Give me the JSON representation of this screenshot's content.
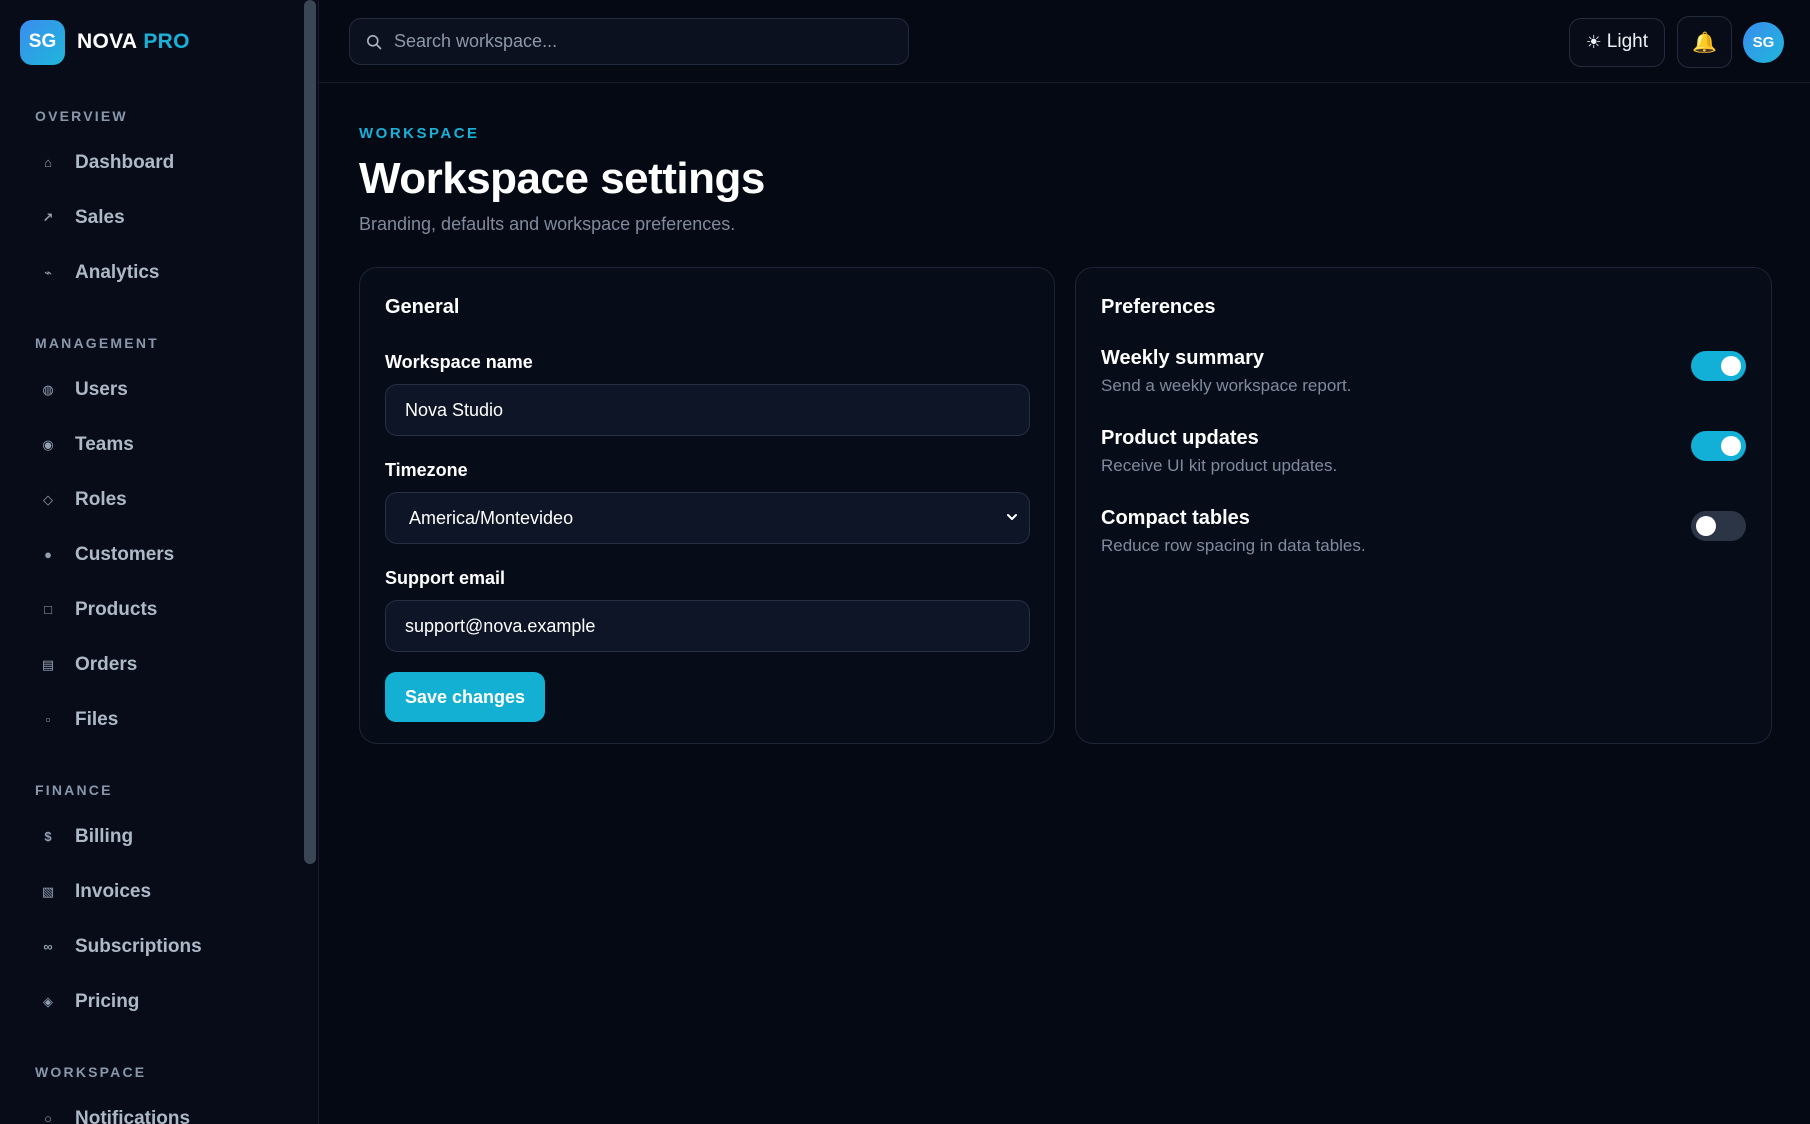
{
  "brand": {
    "logo": "SG",
    "name": "NOVA",
    "accent": "PRO"
  },
  "sidebar": {
    "sections": [
      {
        "title": "OVERVIEW",
        "items": [
          {
            "label": "Dashboard",
            "icon": "⌂"
          },
          {
            "label": "Sales",
            "icon": "↗"
          },
          {
            "label": "Analytics",
            "icon": "⌁"
          }
        ]
      },
      {
        "title": "MANAGEMENT",
        "items": [
          {
            "label": "Users",
            "icon": "◍"
          },
          {
            "label": "Teams",
            "icon": "◉"
          },
          {
            "label": "Roles",
            "icon": "◇"
          },
          {
            "label": "Customers",
            "icon": "●"
          },
          {
            "label": "Products",
            "icon": "□"
          },
          {
            "label": "Orders",
            "icon": "▤"
          },
          {
            "label": "Files",
            "icon": "▫"
          }
        ]
      },
      {
        "title": "FINANCE",
        "items": [
          {
            "label": "Billing",
            "icon": "$"
          },
          {
            "label": "Invoices",
            "icon": "▧"
          },
          {
            "label": "Subscriptions",
            "icon": "∞"
          },
          {
            "label": "Pricing",
            "icon": "◈"
          }
        ]
      },
      {
        "title": "WORKSPACE",
        "items": [
          {
            "label": "Notifications",
            "icon": "○"
          }
        ]
      }
    ]
  },
  "topbar": {
    "search_placeholder": "Search workspace...",
    "theme_label": "Light",
    "theme_icon": "☀",
    "bell_icon": "🔔",
    "avatar": "SG"
  },
  "page": {
    "eyebrow": "WORKSPACE",
    "title": "Workspace settings",
    "subtitle": "Branding, defaults and workspace preferences."
  },
  "general": {
    "title": "General",
    "workspace_name_label": "Workspace name",
    "workspace_name_value": "Nova Studio",
    "timezone_label": "Timezone",
    "timezone_value": "America/Montevideo",
    "support_email_label": "Support email",
    "support_email_value": "support@nova.example",
    "save_label": "Save changes"
  },
  "preferences": {
    "title": "Preferences",
    "items": [
      {
        "title": "Weekly summary",
        "description": "Send a weekly workspace report.",
        "enabled": true
      },
      {
        "title": "Product updates",
        "description": "Receive UI kit product updates.",
        "enabled": true
      },
      {
        "title": "Compact tables",
        "description": "Reduce row spacing in data tables.",
        "enabled": false
      }
    ]
  },
  "colors": {
    "accent": "#14b0d3",
    "background": "#050914",
    "sidebar": "#070c18"
  }
}
